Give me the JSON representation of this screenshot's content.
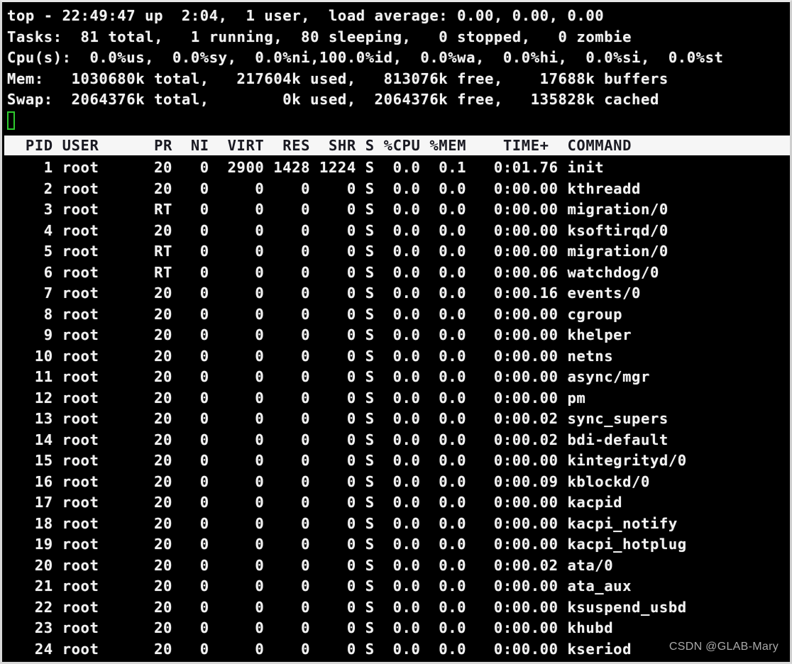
{
  "terminal": {
    "background_color": "#000000",
    "foreground_color": "#f2f2f2",
    "cursor_color": "#2ecc2e",
    "header_bg_color": "#f6f6f6",
    "header_fg_color": "#1a1a22",
    "watermark_color": "#b9b9b9"
  },
  "summary": {
    "uptime_line": "top - 22:49:47 up  2:04,  1 user,  load average: 0.00, 0.00, 0.00",
    "tasks_line": "Tasks:  81 total,   1 running,  80 sleeping,   0 stopped,   0 zombie",
    "cpu_line": "Cpu(s):  0.0%us,  0.0%sy,  0.0%ni,100.0%id,  0.0%wa,  0.0%hi,  0.0%si,  0.0%st",
    "mem_line": "Mem:   1030680k total,   217604k used,   813076k free,    17688k buffers",
    "swap_line": "Swap:  2064376k total,        0k used,  2064376k free,   135828k cached",
    "fields": {
      "time": "22:49:47",
      "uptime": "2:04",
      "users": "1",
      "load_avg_1": "0.00",
      "load_avg_5": "0.00",
      "load_avg_15": "0.00",
      "tasks_total": "81",
      "tasks_running": "1",
      "tasks_sleeping": "80",
      "tasks_stopped": "0",
      "tasks_zombie": "0",
      "cpu_us": "0.0",
      "cpu_sy": "0.0",
      "cpu_ni": "0.0",
      "cpu_id": "100.0",
      "cpu_wa": "0.0",
      "cpu_hi": "0.0",
      "cpu_si": "0.0",
      "cpu_st": "0.0",
      "mem_total": "1030680k",
      "mem_used": "217604k",
      "mem_free": "813076k",
      "mem_buffers": "17688k",
      "swap_total": "2064376k",
      "swap_used": "0k",
      "swap_free": "2064376k",
      "swap_cached": "135828k"
    }
  },
  "cursor": {
    "visible": true,
    "shape": "hollow-block"
  },
  "table": {
    "header_line": "  PID USER      PR  NI  VIRT  RES  SHR S %CPU %MEM    TIME+  COMMAND",
    "columns": [
      "PID",
      "USER",
      "PR",
      "NI",
      "VIRT",
      "RES",
      "SHR",
      "S",
      "%CPU",
      "%MEM",
      "TIME+",
      "COMMAND"
    ],
    "rows": [
      {
        "line": "    1 root      20   0  2900 1428 1224 S  0.0  0.1   0:01.76 init",
        "pid": "1",
        "user": "root",
        "pr": "20",
        "ni": "0",
        "virt": "2900",
        "res": "1428",
        "shr": "1224",
        "s": "S",
        "cpu": "0.0",
        "mem": "0.1",
        "time": "0:01.76",
        "command": "init"
      },
      {
        "line": "    2 root      20   0     0    0    0 S  0.0  0.0   0:00.00 kthreadd",
        "pid": "2",
        "user": "root",
        "pr": "20",
        "ni": "0",
        "virt": "0",
        "res": "0",
        "shr": "0",
        "s": "S",
        "cpu": "0.0",
        "mem": "0.0",
        "time": "0:00.00",
        "command": "kthreadd"
      },
      {
        "line": "    3 root      RT   0     0    0    0 S  0.0  0.0   0:00.00 migration/0",
        "pid": "3",
        "user": "root",
        "pr": "RT",
        "ni": "0",
        "virt": "0",
        "res": "0",
        "shr": "0",
        "s": "S",
        "cpu": "0.0",
        "mem": "0.0",
        "time": "0:00.00",
        "command": "migration/0"
      },
      {
        "line": "    4 root      20   0     0    0    0 S  0.0  0.0   0:00.00 ksoftirqd/0",
        "pid": "4",
        "user": "root",
        "pr": "20",
        "ni": "0",
        "virt": "0",
        "res": "0",
        "shr": "0",
        "s": "S",
        "cpu": "0.0",
        "mem": "0.0",
        "time": "0:00.00",
        "command": "ksoftirqd/0"
      },
      {
        "line": "    5 root      RT   0     0    0    0 S  0.0  0.0   0:00.00 migration/0",
        "pid": "5",
        "user": "root",
        "pr": "RT",
        "ni": "0",
        "virt": "0",
        "res": "0",
        "shr": "0",
        "s": "S",
        "cpu": "0.0",
        "mem": "0.0",
        "time": "0:00.00",
        "command": "migration/0"
      },
      {
        "line": "    6 root      RT   0     0    0    0 S  0.0  0.0   0:00.06 watchdog/0",
        "pid": "6",
        "user": "root",
        "pr": "RT",
        "ni": "0",
        "virt": "0",
        "res": "0",
        "shr": "0",
        "s": "S",
        "cpu": "0.0",
        "mem": "0.0",
        "time": "0:00.06",
        "command": "watchdog/0"
      },
      {
        "line": "    7 root      20   0     0    0    0 S  0.0  0.0   0:00.16 events/0",
        "pid": "7",
        "user": "root",
        "pr": "20",
        "ni": "0",
        "virt": "0",
        "res": "0",
        "shr": "0",
        "s": "S",
        "cpu": "0.0",
        "mem": "0.0",
        "time": "0:00.16",
        "command": "events/0"
      },
      {
        "line": "    8 root      20   0     0    0    0 S  0.0  0.0   0:00.00 cgroup",
        "pid": "8",
        "user": "root",
        "pr": "20",
        "ni": "0",
        "virt": "0",
        "res": "0",
        "shr": "0",
        "s": "S",
        "cpu": "0.0",
        "mem": "0.0",
        "time": "0:00.00",
        "command": "cgroup"
      },
      {
        "line": "    9 root      20   0     0    0    0 S  0.0  0.0   0:00.00 khelper",
        "pid": "9",
        "user": "root",
        "pr": "20",
        "ni": "0",
        "virt": "0",
        "res": "0",
        "shr": "0",
        "s": "S",
        "cpu": "0.0",
        "mem": "0.0",
        "time": "0:00.00",
        "command": "khelper"
      },
      {
        "line": "   10 root      20   0     0    0    0 S  0.0  0.0   0:00.00 netns",
        "pid": "10",
        "user": "root",
        "pr": "20",
        "ni": "0",
        "virt": "0",
        "res": "0",
        "shr": "0",
        "s": "S",
        "cpu": "0.0",
        "mem": "0.0",
        "time": "0:00.00",
        "command": "netns"
      },
      {
        "line": "   11 root      20   0     0    0    0 S  0.0  0.0   0:00.00 async/mgr",
        "pid": "11",
        "user": "root",
        "pr": "20",
        "ni": "0",
        "virt": "0",
        "res": "0",
        "shr": "0",
        "s": "S",
        "cpu": "0.0",
        "mem": "0.0",
        "time": "0:00.00",
        "command": "async/mgr"
      },
      {
        "line": "   12 root      20   0     0    0    0 S  0.0  0.0   0:00.00 pm",
        "pid": "12",
        "user": "root",
        "pr": "20",
        "ni": "0",
        "virt": "0",
        "res": "0",
        "shr": "0",
        "s": "S",
        "cpu": "0.0",
        "mem": "0.0",
        "time": "0:00.00",
        "command": "pm"
      },
      {
        "line": "   13 root      20   0     0    0    0 S  0.0  0.0   0:00.02 sync_supers",
        "pid": "13",
        "user": "root",
        "pr": "20",
        "ni": "0",
        "virt": "0",
        "res": "0",
        "shr": "0",
        "s": "S",
        "cpu": "0.0",
        "mem": "0.0",
        "time": "0:00.02",
        "command": "sync_supers"
      },
      {
        "line": "   14 root      20   0     0    0    0 S  0.0  0.0   0:00.02 bdi-default",
        "pid": "14",
        "user": "root",
        "pr": "20",
        "ni": "0",
        "virt": "0",
        "res": "0",
        "shr": "0",
        "s": "S",
        "cpu": "0.0",
        "mem": "0.0",
        "time": "0:00.02",
        "command": "bdi-default"
      },
      {
        "line": "   15 root      20   0     0    0    0 S  0.0  0.0   0:00.00 kintegrityd/0",
        "pid": "15",
        "user": "root",
        "pr": "20",
        "ni": "0",
        "virt": "0",
        "res": "0",
        "shr": "0",
        "s": "S",
        "cpu": "0.0",
        "mem": "0.0",
        "time": "0:00.00",
        "command": "kintegrityd/0"
      },
      {
        "line": "   16 root      20   0     0    0    0 S  0.0  0.0   0:00.09 kblockd/0",
        "pid": "16",
        "user": "root",
        "pr": "20",
        "ni": "0",
        "virt": "0",
        "res": "0",
        "shr": "0",
        "s": "S",
        "cpu": "0.0",
        "mem": "0.0",
        "time": "0:00.09",
        "command": "kblockd/0"
      },
      {
        "line": "   17 root      20   0     0    0    0 S  0.0  0.0   0:00.00 kacpid",
        "pid": "17",
        "user": "root",
        "pr": "20",
        "ni": "0",
        "virt": "0",
        "res": "0",
        "shr": "0",
        "s": "S",
        "cpu": "0.0",
        "mem": "0.0",
        "time": "0:00.00",
        "command": "kacpid"
      },
      {
        "line": "   18 root      20   0     0    0    0 S  0.0  0.0   0:00.00 kacpi_notify",
        "pid": "18",
        "user": "root",
        "pr": "20",
        "ni": "0",
        "virt": "0",
        "res": "0",
        "shr": "0",
        "s": "S",
        "cpu": "0.0",
        "mem": "0.0",
        "time": "0:00.00",
        "command": "kacpi_notify"
      },
      {
        "line": "   19 root      20   0     0    0    0 S  0.0  0.0   0:00.00 kacpi_hotplug",
        "pid": "19",
        "user": "root",
        "pr": "20",
        "ni": "0",
        "virt": "0",
        "res": "0",
        "shr": "0",
        "s": "S",
        "cpu": "0.0",
        "mem": "0.0",
        "time": "0:00.00",
        "command": "kacpi_hotplug"
      },
      {
        "line": "   20 root      20   0     0    0    0 S  0.0  0.0   0:00.02 ata/0",
        "pid": "20",
        "user": "root",
        "pr": "20",
        "ni": "0",
        "virt": "0",
        "res": "0",
        "shr": "0",
        "s": "S",
        "cpu": "0.0",
        "mem": "0.0",
        "time": "0:00.02",
        "command": "ata/0"
      },
      {
        "line": "   21 root      20   0     0    0    0 S  0.0  0.0   0:00.00 ata_aux",
        "pid": "21",
        "user": "root",
        "pr": "20",
        "ni": "0",
        "virt": "0",
        "res": "0",
        "shr": "0",
        "s": "S",
        "cpu": "0.0",
        "mem": "0.0",
        "time": "0:00.00",
        "command": "ata_aux"
      },
      {
        "line": "   22 root      20   0     0    0    0 S  0.0  0.0   0:00.00 ksuspend_usbd",
        "pid": "22",
        "user": "root",
        "pr": "20",
        "ni": "0",
        "virt": "0",
        "res": "0",
        "shr": "0",
        "s": "S",
        "cpu": "0.0",
        "mem": "0.0",
        "time": "0:00.00",
        "command": "ksuspend_usbd"
      },
      {
        "line": "   23 root      20   0     0    0    0 S  0.0  0.0   0:00.00 khubd",
        "pid": "23",
        "user": "root",
        "pr": "20",
        "ni": "0",
        "virt": "0",
        "res": "0",
        "shr": "0",
        "s": "S",
        "cpu": "0.0",
        "mem": "0.0",
        "time": "0:00.00",
        "command": "khubd"
      },
      {
        "line": "   24 root      20   0     0    0    0 S  0.0  0.0   0:00.00 kseriod",
        "pid": "24",
        "user": "root",
        "pr": "20",
        "ni": "0",
        "virt": "0",
        "res": "0",
        "shr": "0",
        "s": "S",
        "cpu": "0.0",
        "mem": "0.0",
        "time": "0:00.00",
        "command": "kseriod"
      }
    ]
  },
  "watermark": {
    "text": "CSDN @GLAB-Mary"
  }
}
